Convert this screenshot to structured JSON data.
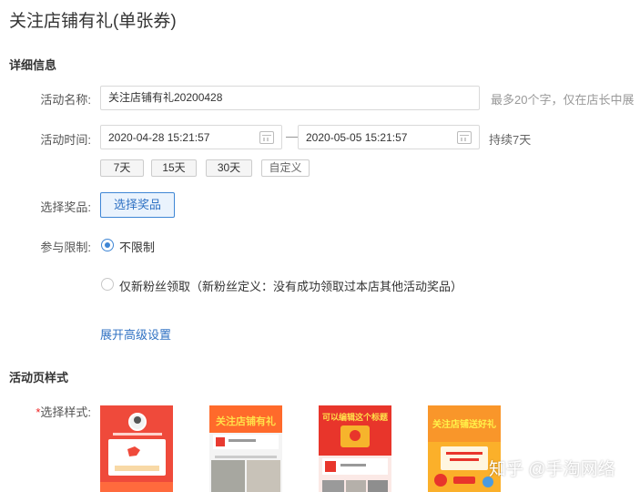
{
  "page": {
    "title": "关注店铺有礼(单张券)"
  },
  "details": {
    "section_title": "详细信息",
    "name": {
      "label": "活动名称:",
      "value": "关注店铺有礼20200428",
      "hint": "最多20个字，仅在店长中展"
    },
    "time": {
      "label": "活动时间:",
      "start": "2020-04-28 15:21:57",
      "separator": "—",
      "end": "2020-05-05 15:21:57",
      "duration": "持续7天",
      "quick": [
        "7天",
        "15天",
        "30天",
        "自定义"
      ]
    },
    "prize": {
      "label": "选择奖品:",
      "button": "选择奖品"
    },
    "limit": {
      "label": "参与限制:",
      "options": [
        {
          "label": "不限制",
          "selected": true
        },
        {
          "label": "仅新粉丝领取（新粉丝定义：没有成功领取过本店其他活动奖品）",
          "selected": false
        }
      ]
    },
    "advanced_link": "展开高级设置"
  },
  "style_section": {
    "section_title": "活动页样式",
    "required_mark": "*",
    "label": "选择样式:",
    "templates": [
      {
        "banner": ""
      },
      {
        "banner": "关注店铺有礼"
      },
      {
        "banner": "可以编辑这个标题"
      },
      {
        "banner": "关注店铺送好礼"
      }
    ]
  },
  "watermark": "知乎 @手淘网络",
  "colors": {
    "accent": "#3f86d5",
    "link": "#3072c3",
    "red": "#e83a30",
    "orange": "#f7a21b"
  }
}
